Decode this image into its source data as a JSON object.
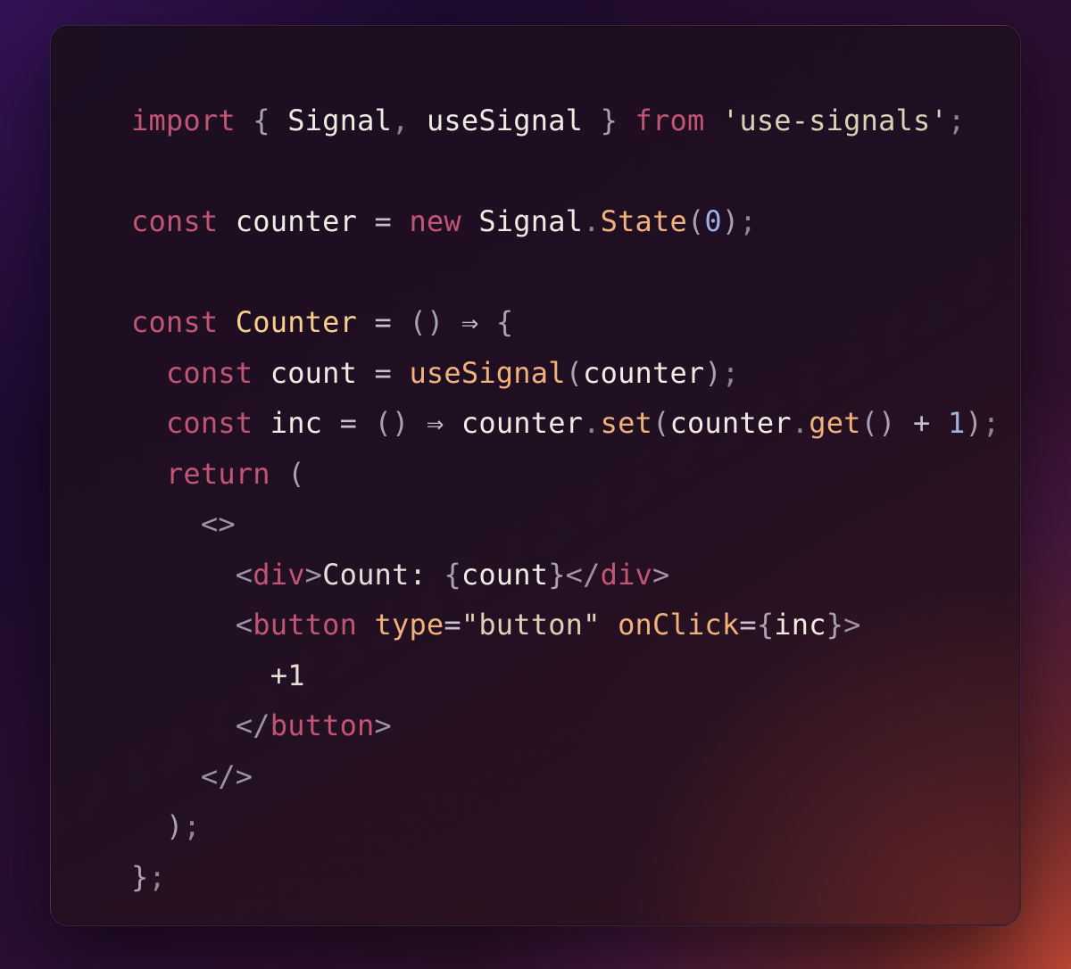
{
  "code": {
    "tokens": {
      "import": "import",
      "from": "from",
      "const": "const",
      "new": "new",
      "return": "return",
      "lbrace": "{",
      "rbrace": "}",
      "lparen": "(",
      "rparen": ")",
      "semi": ";",
      "comma": ",",
      "dot": ".",
      "eq": "=",
      "arrow": "⇒",
      "plus": "+",
      "lt": "<",
      "gt": ">",
      "slash": "/",
      "frag_open": "<>",
      "frag_close": "</>",
      "signal": "Signal",
      "useSignal": "useSignal",
      "module": "'use-signals'",
      "counter": "counter",
      "state": "State",
      "zero": "0",
      "one": "1",
      "Counter": "Counter",
      "count": "count",
      "inc": "inc",
      "set": "set",
      "get": "get",
      "div": "div",
      "button": "button",
      "type_attr": "type",
      "type_val": "\"button\"",
      "onClick": "onClick",
      "count_label": "Count: ",
      "plus_one_text": "+1"
    }
  }
}
